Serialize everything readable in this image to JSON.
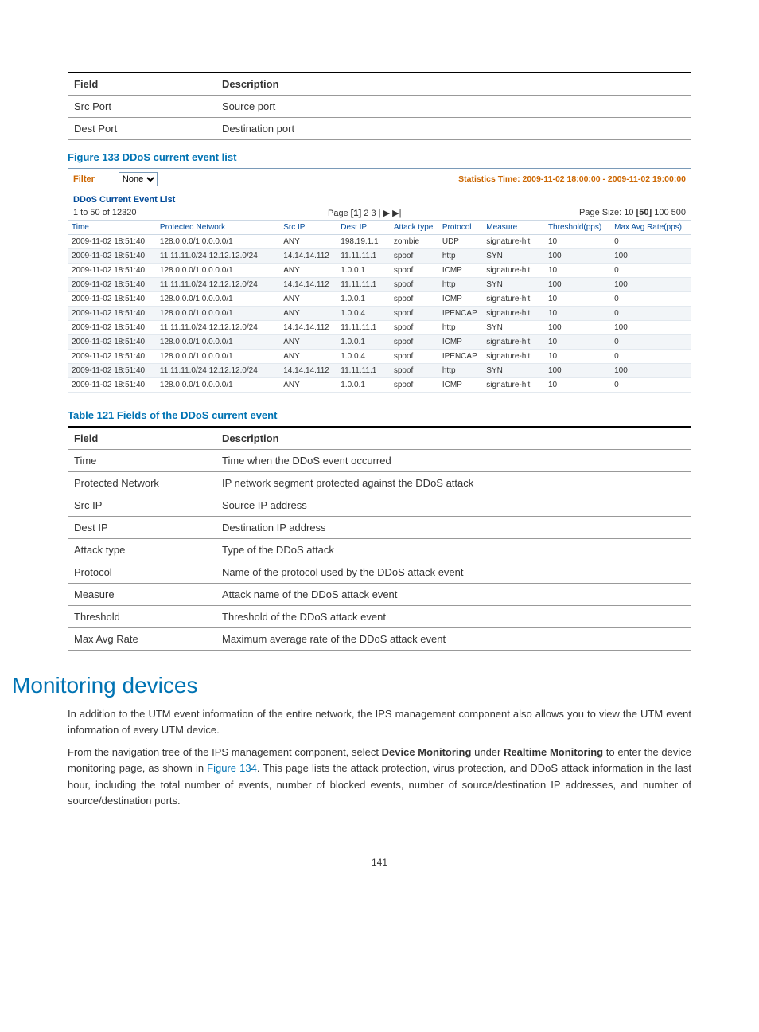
{
  "table_top": {
    "headers": [
      "Field",
      "Description"
    ],
    "rows": [
      [
        "Src Port",
        "Source port"
      ],
      [
        "Dest Port",
        "Destination port"
      ]
    ]
  },
  "figure_caption": "Figure 133 DDoS current event list",
  "shot": {
    "filter_label": "Filter",
    "filter_value": "None",
    "stats_time": "Statistics Time: 2009-11-02 18:00:00 - 2009-11-02 19:00:00",
    "panel_title": "DDoS Current Event List",
    "count_text": "1 to 50 of 12320",
    "page_label": "Page",
    "pages": [
      "[1]",
      "2",
      "3",
      "|",
      "▶",
      "▶|"
    ],
    "size_label": "Page Size:",
    "sizes": [
      "10",
      "[50]",
      "100",
      "500"
    ],
    "cols": [
      "Time",
      "Protected Network",
      "Src IP",
      "Dest IP",
      "Attack type",
      "Protocol",
      "Measure",
      "Threshold(pps)",
      "Max Avg Rate(pps)"
    ],
    "rows": [
      [
        "2009-11-02 18:51:40",
        "128.0.0.0/1 0.0.0.0/1",
        "ANY",
        "198.19.1.1",
        "zombie",
        "UDP",
        "signature-hit",
        "10",
        "0"
      ],
      [
        "2009-11-02 18:51:40",
        "11.11.11.0/24 12.12.12.0/24",
        "14.14.14.112",
        "11.11.11.1",
        "spoof",
        "http",
        "SYN",
        "100",
        "100"
      ],
      [
        "2009-11-02 18:51:40",
        "128.0.0.0/1 0.0.0.0/1",
        "ANY",
        "1.0.0.1",
        "spoof",
        "ICMP",
        "signature-hit",
        "10",
        "0"
      ],
      [
        "2009-11-02 18:51:40",
        "11.11.11.0/24 12.12.12.0/24",
        "14.14.14.112",
        "11.11.11.1",
        "spoof",
        "http",
        "SYN",
        "100",
        "100"
      ],
      [
        "2009-11-02 18:51:40",
        "128.0.0.0/1 0.0.0.0/1",
        "ANY",
        "1.0.0.1",
        "spoof",
        "ICMP",
        "signature-hit",
        "10",
        "0"
      ],
      [
        "2009-11-02 18:51:40",
        "128.0.0.0/1 0.0.0.0/1",
        "ANY",
        "1.0.0.4",
        "spoof",
        "IPENCAP",
        "signature-hit",
        "10",
        "0"
      ],
      [
        "2009-11-02 18:51:40",
        "11.11.11.0/24 12.12.12.0/24",
        "14.14.14.112",
        "11.11.11.1",
        "spoof",
        "http",
        "SYN",
        "100",
        "100"
      ],
      [
        "2009-11-02 18:51:40",
        "128.0.0.0/1 0.0.0.0/1",
        "ANY",
        "1.0.0.1",
        "spoof",
        "ICMP",
        "signature-hit",
        "10",
        "0"
      ],
      [
        "2009-11-02 18:51:40",
        "128.0.0.0/1 0.0.0.0/1",
        "ANY",
        "1.0.0.4",
        "spoof",
        "IPENCAP",
        "signature-hit",
        "10",
        "0"
      ],
      [
        "2009-11-02 18:51:40",
        "11.11.11.0/24 12.12.12.0/24",
        "14.14.14.112",
        "11.11.11.1",
        "spoof",
        "http",
        "SYN",
        "100",
        "100"
      ],
      [
        "2009-11-02 18:51:40",
        "128.0.0.0/1 0.0.0.0/1",
        "ANY",
        "1.0.0.1",
        "spoof",
        "ICMP",
        "signature-hit",
        "10",
        "0"
      ]
    ]
  },
  "table121": {
    "caption": "Table 121 Fields of the DDoS current event",
    "headers": [
      "Field",
      "Description"
    ],
    "rows": [
      [
        "Time",
        "Time when the DDoS event occurred"
      ],
      [
        "Protected Network",
        "IP network segment protected against the DDoS attack"
      ],
      [
        "Src IP",
        "Source IP address"
      ],
      [
        "Dest IP",
        "Destination IP address"
      ],
      [
        "Attack type",
        "Type of the DDoS attack"
      ],
      [
        "Protocol",
        "Name of the protocol used by the DDoS attack event"
      ],
      [
        "Measure",
        "Attack name of the DDoS attack event"
      ],
      [
        "Threshold",
        "Threshold of the DDoS attack event"
      ],
      [
        "Max Avg Rate",
        "Maximum average rate of the DDoS attack event"
      ]
    ]
  },
  "section_heading": "Monitoring devices",
  "para1": "In addition to the UTM event information of the entire network, the IPS management component also allows you to view the UTM event information of every UTM device.",
  "para2_a": "From the navigation tree of the IPS management component, select ",
  "para2_b": "Device Monitoring",
  "para2_c": " under ",
  "para2_d": "Realtime Monitoring",
  "para2_e": " to enter the device monitoring page, as shown in ",
  "para2_f": "Figure 134",
  "para2_g": ". This page lists the attack protection, virus protection, and DDoS attack information in the last hour, including the total number of events, number of blocked events, number of source/destination IP addresses, and number of source/destination ports.",
  "page_number": "141"
}
